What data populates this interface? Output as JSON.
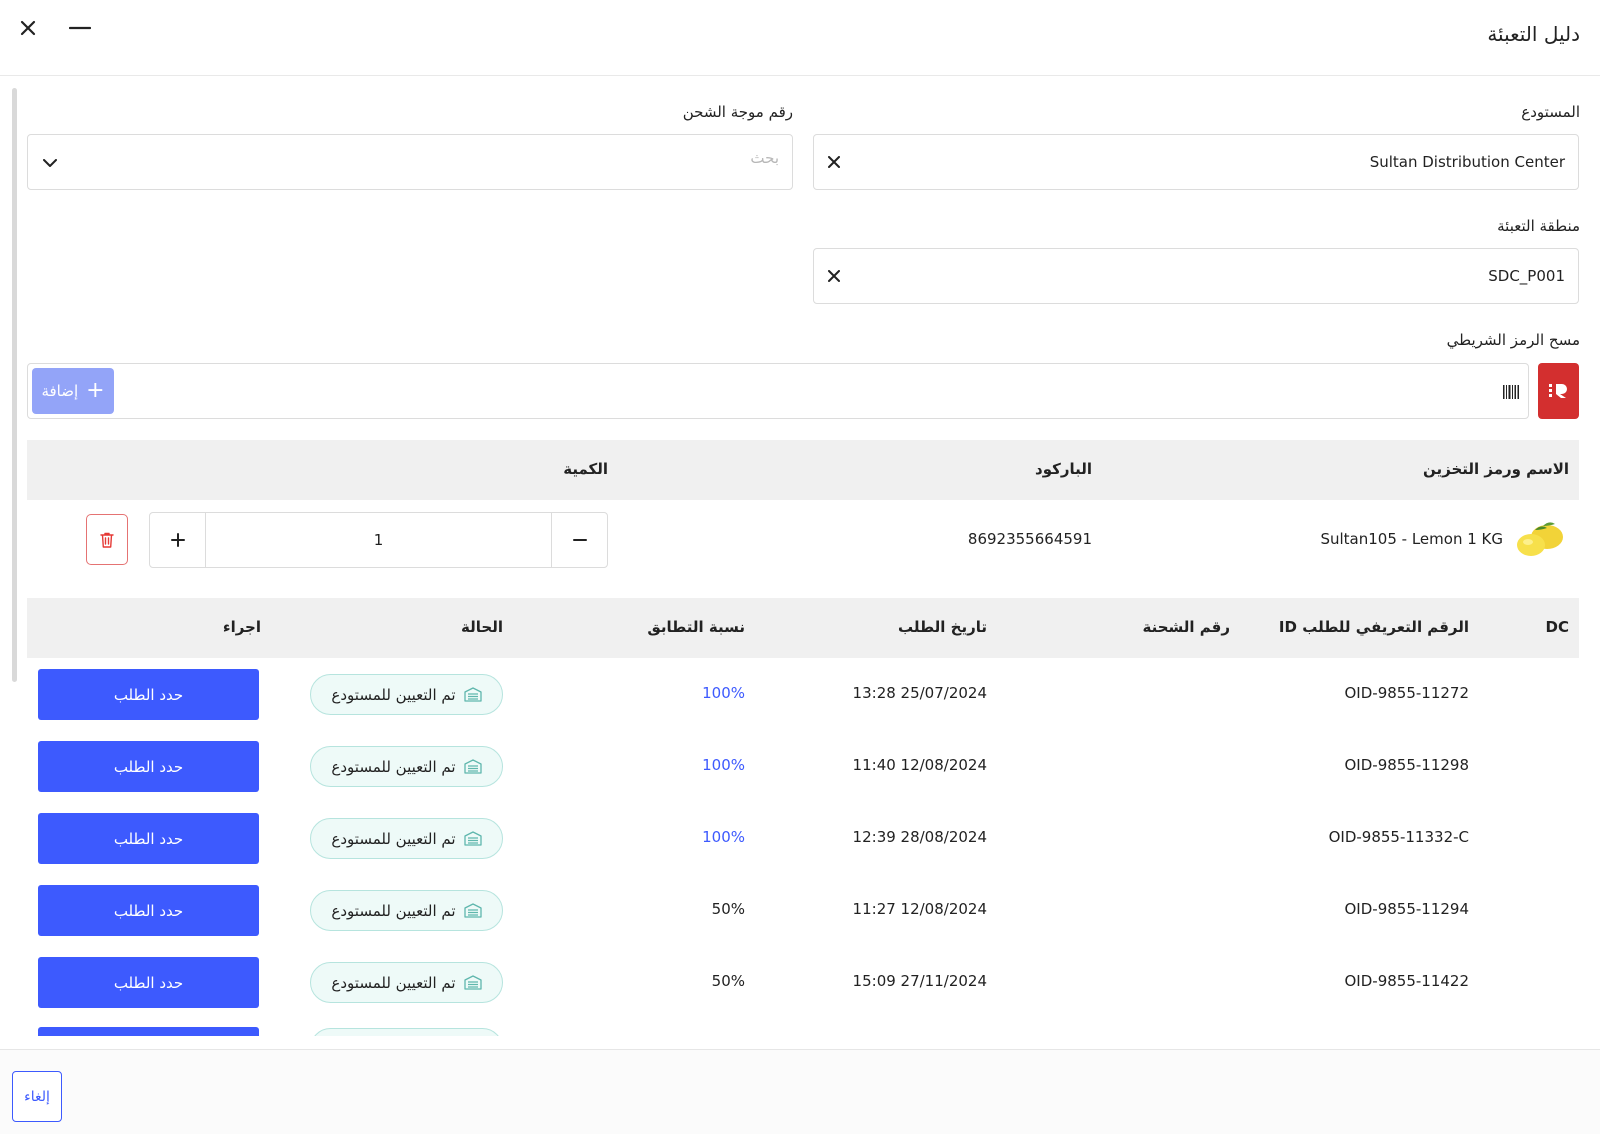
{
  "header": {
    "title": "دليل التعبئة"
  },
  "form": {
    "warehouse": {
      "label": "المستودع",
      "value": "Sultan Distribution Center"
    },
    "wave": {
      "label": "رقم موجة الشحن",
      "placeholder": "بحث"
    },
    "packing_zone": {
      "label": "منطقة التعبئة",
      "value": "SDC_P001"
    },
    "barcode": {
      "label": "مسح الرمز الشريطي",
      "add_label": "إضافة"
    }
  },
  "items_table": {
    "columns": {
      "name": "الاسم ورمز التخزين",
      "barcode": "الباركود",
      "quantity": "الكمية"
    },
    "rows": [
      {
        "name": "Sultan105 - Lemon 1 KG",
        "barcode": "8692355664591",
        "quantity": "1"
      }
    ]
  },
  "orders_table": {
    "columns": {
      "dc": "DC",
      "order_id": "الرقم التعريفي للطلب ID",
      "shipment": "رقم الشحنة",
      "date": "تاريخ الطلب",
      "match": "نسبة التطابق",
      "status": "الحالة",
      "action": "اجراء"
    },
    "rows": [
      {
        "order_id": "OID-9855-11272",
        "shipment": "",
        "date": "13:28 25/07/2024",
        "match": "100%",
        "status": "تم التعيين للمستودع",
        "action": "حدد الطلب"
      },
      {
        "order_id": "OID-9855-11298",
        "shipment": "",
        "date": "11:40 12/08/2024",
        "match": "100%",
        "status": "تم التعيين للمستودع",
        "action": "حدد الطلب"
      },
      {
        "order_id": "OID-9855-11332-C",
        "shipment": "",
        "date": "12:39 28/08/2024",
        "match": "100%",
        "status": "تم التعيين للمستودع",
        "action": "حدد الطلب"
      },
      {
        "order_id": "OID-9855-11294",
        "shipment": "",
        "date": "11:27 12/08/2024",
        "match": "50%",
        "status": "تم التعيين للمستودع",
        "action": "حدد الطلب"
      },
      {
        "order_id": "OID-9855-11422",
        "shipment": "",
        "date": "15:09 27/11/2024",
        "match": "50%",
        "status": "تم التعيين للمستودع",
        "action": "حدد الطلب"
      }
    ]
  },
  "footer": {
    "cancel_label": "إلغاء"
  },
  "colors": {
    "primary": "#3d5afe",
    "danger": "#d32f2f",
    "status_bg": "#eefaf8",
    "add_button": "#93a4f8"
  }
}
